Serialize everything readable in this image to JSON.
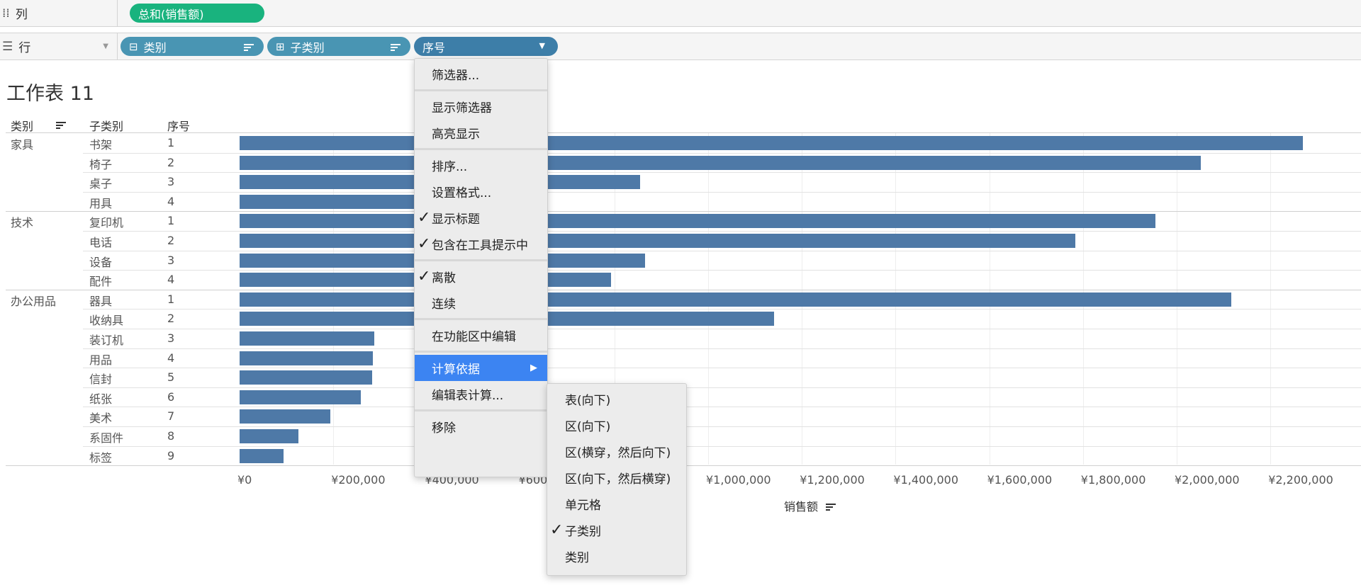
{
  "shelves": {
    "columns": {
      "label": "列",
      "pills": [
        "总和(销售额)"
      ]
    },
    "rows": {
      "label": "行",
      "pills": [
        "类别",
        "子类别",
        "序号"
      ]
    }
  },
  "sheet": {
    "title": "工作表 11"
  },
  "table_headers": [
    "类别",
    "子类别",
    "序号"
  ],
  "table": {
    "groups": [
      {
        "category": "家具",
        "rows": [
          {
            "sub": "书架",
            "idx": "1",
            "value": 2270000
          },
          {
            "sub": "椅子",
            "idx": "2",
            "value": 2052000
          },
          {
            "sub": "桌子",
            "idx": "3",
            "value": 855000
          },
          {
            "sub": "用具",
            "idx": "4",
            "value": 390000
          }
        ]
      },
      {
        "category": "技术",
        "rows": [
          {
            "sub": "复印机",
            "idx": "1",
            "value": 1955000
          },
          {
            "sub": "电话",
            "idx": "2",
            "value": 1783000
          },
          {
            "sub": "设备",
            "idx": "3",
            "value": 865000
          },
          {
            "sub": "配件",
            "idx": "4",
            "value": 793000
          }
        ]
      },
      {
        "category": "办公用品",
        "rows": [
          {
            "sub": "器具",
            "idx": "1",
            "value": 2116000
          },
          {
            "sub": "收纳具",
            "idx": "2",
            "value": 1140000
          },
          {
            "sub": "装订机",
            "idx": "3",
            "value": 287000
          },
          {
            "sub": "用品",
            "idx": "4",
            "value": 285000
          },
          {
            "sub": "信封",
            "idx": "5",
            "value": 283000
          },
          {
            "sub": "纸张",
            "idx": "6",
            "value": 258000
          },
          {
            "sub": "美术",
            "idx": "7",
            "value": 194000
          },
          {
            "sub": "系固件",
            "idx": "8",
            "value": 125000
          },
          {
            "sub": "标签",
            "idx": "9",
            "value": 94000
          }
        ]
      }
    ]
  },
  "chart_data": {
    "type": "bar",
    "orientation": "horizontal",
    "categories": [
      "书架",
      "椅子",
      "桌子",
      "用具",
      "复印机",
      "电话",
      "设备",
      "配件",
      "器具",
      "收纳具",
      "装订机",
      "用品",
      "信封",
      "纸张",
      "美术",
      "系固件",
      "标签"
    ],
    "values": [
      2270000,
      2052000,
      855000,
      390000,
      1955000,
      1783000,
      865000,
      793000,
      2116000,
      1140000,
      287000,
      285000,
      283000,
      258000,
      194000,
      125000,
      94000
    ],
    "xlabel": "销售额",
    "xlim": [
      0,
      2300000
    ],
    "xticks": [
      "¥0",
      "¥200,000",
      "¥400,000",
      "¥600,000",
      "¥800,000",
      "¥1,000,000",
      "¥1,200,000",
      "¥1,400,000",
      "¥1,600,000",
      "¥1,800,000",
      "¥2,000,000",
      "¥2,200,000"
    ],
    "grid": true,
    "color": "#4e79a7"
  },
  "context_menu": {
    "items": [
      {
        "label": "筛选器...",
        "checked": false
      },
      {
        "sep": true
      },
      {
        "label": "显示筛选器",
        "checked": false
      },
      {
        "label": "高亮显示",
        "checked": false
      },
      {
        "sep": true
      },
      {
        "label": "排序...",
        "checked": false
      },
      {
        "label": "设置格式...",
        "checked": false
      },
      {
        "label": "显示标题",
        "checked": true
      },
      {
        "label": "包含在工具提示中",
        "checked": true
      },
      {
        "sep": true
      },
      {
        "label": "离散",
        "checked": true
      },
      {
        "label": "连续",
        "checked": false
      },
      {
        "sep": true
      },
      {
        "label": "在功能区中编辑",
        "checked": false
      },
      {
        "sep": true
      },
      {
        "label": "计算依据",
        "checked": false,
        "highlighted": true,
        "submenu": true
      },
      {
        "label": "编辑表计算...",
        "checked": false
      },
      {
        "sep": true
      },
      {
        "label": "移除",
        "checked": false
      }
    ]
  },
  "submenu": {
    "items": [
      {
        "label": "表(向下)",
        "checked": false
      },
      {
        "label": "区(向下)",
        "checked": false
      },
      {
        "label": "区(横穿，然后向下)",
        "checked": false
      },
      {
        "label": "区(向下，然后横穿)",
        "checked": false
      },
      {
        "label": "单元格",
        "checked": false
      },
      {
        "label": "子类别",
        "checked": true
      },
      {
        "label": "类别",
        "checked": false
      }
    ]
  },
  "colors": {
    "bar": "#4e79a7",
    "pill_green": "#19b37e",
    "pill_blue": "#4995b3",
    "menu_highlight": "#3c84f2"
  }
}
